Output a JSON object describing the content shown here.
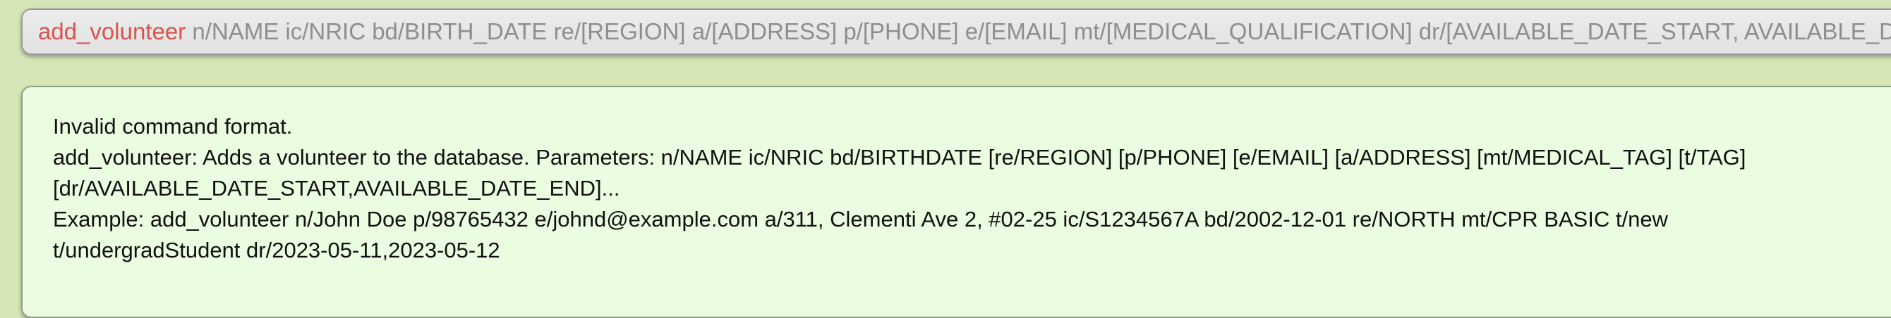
{
  "command_box": {
    "command_word": "add_volunteer",
    "command_params": " n/NAME ic/NRIC bd/BIRTH_DATE re/[REGION] a/[ADDRESS] p/[PHONE] e/[EMAIL] mt/[MEDICAL_QUALIFICATION] dr/[AVAILABLE_DATE_START, AVAILABLE_DATE_END]"
  },
  "result_display": {
    "lines": [
      "Invalid command format.",
      "add_volunteer: Adds a volunteer to the database. Parameters: n/NAME ic/NRIC bd/BIRTHDATE [re/REGION] [p/PHONE] [e/EMAIL] [a/ADDRESS] [mt/MEDICAL_TAG] [t/TAG] [dr/AVAILABLE_DATE_START,AVAILABLE_DATE_END]...",
      "Example: add_volunteer n/John Doe p/98765432 e/johnd@example.com a/311, Clementi Ave 2, #02-25 ic/S1234567A bd/2002-12-01 re/NORTH mt/CPR BASIC t/new t/undergradStudent dr/2023-05-11,2023-05-12"
    ]
  },
  "colors": {
    "background": "#d6e6b6",
    "command_word": "#d9544e",
    "command_params": "#8e8e8e",
    "result_background": "#ebfde0"
  }
}
